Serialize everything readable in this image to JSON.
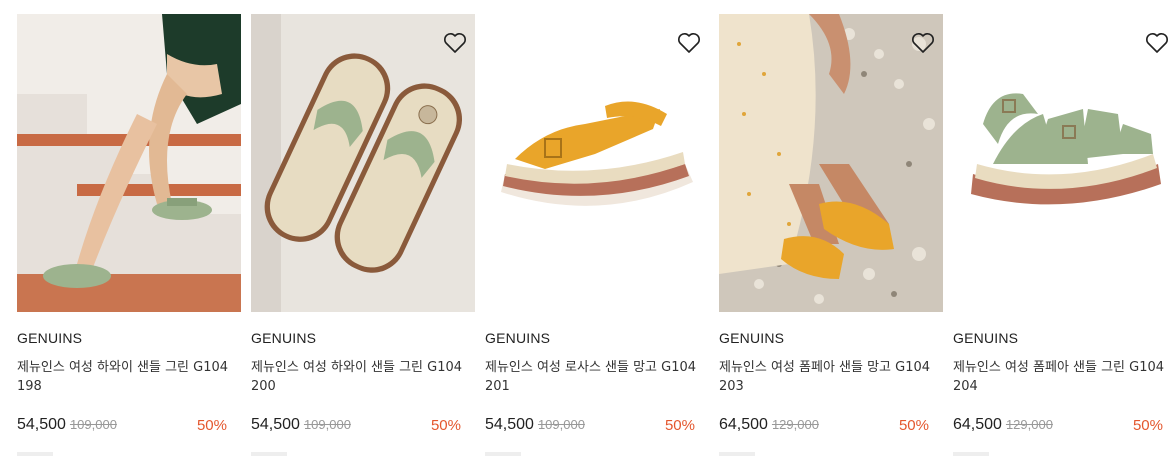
{
  "products": [
    {
      "brand": "GENUINS",
      "name": "제뉴인스 여성 하와이 샌들 그린 G104198",
      "price": "54,500",
      "original_price": "109,000",
      "discount": "50%",
      "wishlist_icon": "heart-outline-icon",
      "image": "sandal-on-stairs"
    },
    {
      "brand": "GENUINS",
      "name": "제뉴인스 여성 하와이 샌들 그린 G104200",
      "price": "54,500",
      "original_price": "109,000",
      "discount": "50%",
      "wishlist_icon": "heart-outline-icon",
      "image": "green-thong-sandals-pair"
    },
    {
      "brand": "GENUINS",
      "name": "제뉴인스 여성 로사스 샌들 망고 G104201",
      "price": "54,500",
      "original_price": "109,000",
      "discount": "50%",
      "wishlist_icon": "heart-outline-icon",
      "image": "mango-thong-sandal"
    },
    {
      "brand": "GENUINS",
      "name": "제뉴인스 여성 폼페아 샌들 망고 G104203",
      "price": "64,500",
      "original_price": "129,000",
      "discount": "50%",
      "wishlist_icon": "heart-outline-icon",
      "image": "mango-strap-sandals-on-pebbles"
    },
    {
      "brand": "GENUINS",
      "name": "제뉴인스 여성 폼페아 샌들 그린 G104204",
      "price": "64,500",
      "original_price": "129,000",
      "discount": "50%",
      "wishlist_icon": "heart-outline-icon",
      "image": "green-strap-sandal"
    }
  ],
  "colors": {
    "discount": "#e4572e",
    "text": "#222222",
    "muted": "#999999",
    "green_suede": "#9db38e",
    "mango": "#e9a52a"
  }
}
